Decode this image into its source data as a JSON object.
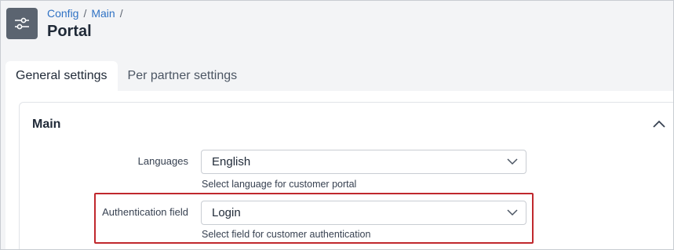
{
  "breadcrumb": {
    "items": [
      "Config",
      "Main"
    ],
    "separator": "/"
  },
  "page": {
    "title": "Portal",
    "icon": "sliders-icon"
  },
  "tabs": [
    {
      "label": "General settings",
      "active": true
    },
    {
      "label": "Per partner settings",
      "active": false
    }
  ],
  "section": {
    "title": "Main",
    "collapse_icon": "chevron-up-icon"
  },
  "fields": {
    "languages": {
      "label": "Languages",
      "value": "English",
      "help": "Select language for customer portal"
    },
    "authentication": {
      "label": "Authentication field",
      "value": "Login",
      "help": "Select field for customer authentication"
    }
  },
  "colors": {
    "link": "#2f72c4",
    "header_icon_bg": "#5b6470",
    "highlight": "#c0282d"
  }
}
